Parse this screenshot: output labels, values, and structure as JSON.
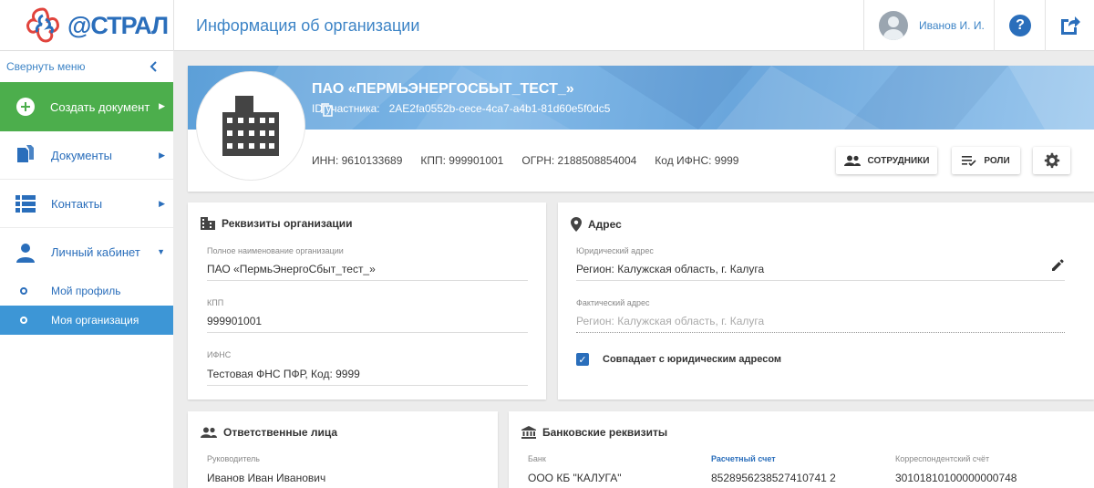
{
  "app": {
    "logo_text": "@СТРАЛ",
    "page_title": "Информация об организации",
    "user_name": "Иванов И. И.",
    "help_label": "?"
  },
  "sidebar": {
    "collapse_label": "Свернуть меню",
    "create_label": "Создать документ",
    "items": [
      {
        "label": "Документы"
      },
      {
        "label": "Контакты"
      },
      {
        "label": "Личный кабинет"
      }
    ],
    "subitems": [
      {
        "label": "Мой профиль"
      },
      {
        "label": "Моя организация"
      }
    ]
  },
  "org": {
    "name": "ПАО «ПЕРМЬЭНЕРГОСБЫТ_ТЕСТ_»",
    "id_label": "ID участника:",
    "id_value": "2AE2fa0552b-cece-4ca7-a4b1-81d60e5f0dc5",
    "inn": "ИНН: 9610133689",
    "kpp": "КПП: 999901001",
    "ogrn": "ОГРН: 2188508854004",
    "ifns": "Код ИФНС: 9999",
    "btn_employees": "СОТРУДНИКИ",
    "btn_roles": "РОЛИ"
  },
  "requisites": {
    "title": "Реквизиты организации",
    "full_name_label": "Полное наименование организации",
    "full_name_value": "ПАО «ПермьЭнергоСбыт_тест_»",
    "kpp_label": "КПП",
    "kpp_value": "999901001",
    "ifns_label": "ИФНС",
    "ifns_value": "Тестовая ФНС ПФР, Код: 9999"
  },
  "address": {
    "title": "Адрес",
    "legal_label": "Юридический адрес",
    "legal_value": "Регион: Калужская область, г. Калуга",
    "actual_label": "Фактический адрес",
    "actual_value": "Регион: Калужская область, г. Калуга",
    "same_label": "Совпадает с юридическим адресом",
    "check_mark": "✓"
  },
  "responsible": {
    "title": "Ответственные лица",
    "head_label": "Руководитель",
    "head_value": "Иванов Иван Иванович"
  },
  "bank": {
    "title": "Банковские реквизиты",
    "bank_label": "Банк",
    "bank_value": "ООО КБ \"КАЛУГА\"",
    "account_label": "Расчетный счет",
    "account_value": "8528956238527410741 2",
    "corr_label": "Корреспондентский счёт",
    "corr_value": "30101810100000000748"
  },
  "colors": {
    "accent": "#2a6ebb",
    "green": "#4cae4c",
    "active": "#3d96d6"
  }
}
